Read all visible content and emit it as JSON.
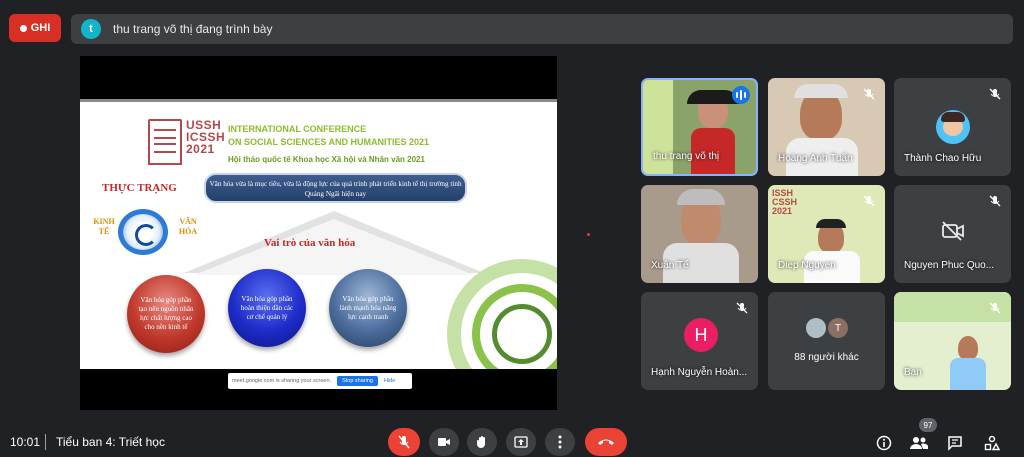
{
  "recording": {
    "label": "GHI"
  },
  "presenter_bar": {
    "avatar_letter": "t",
    "text": "thu trang võ thị đang trình bày"
  },
  "slide": {
    "logo_code": [
      "USSH",
      "ICSSH",
      "2021"
    ],
    "conference_title_line1": "INTERNATIONAL CONFERENCE",
    "conference_title_line2": "ON SOCIAL SCIENCES AND HUMANITIES 2021",
    "conference_subtitle": "Hội thảo quốc tế Khoa học Xã hội và Nhân văn 2021",
    "status_heading": "THỰC TRẠNG",
    "banner_text": "Văn hóa vừa là mục tiêu, vừa là động lực của quá trình phát triển kinh tế thị trường tỉnh Quảng Ngãi hiện nay",
    "econ_label": "KINH TẾ",
    "culture_label": "VĂN HÓA",
    "role_title": "Vai trò của văn hóa",
    "bubbles": [
      "Văn hóa góp phần tạo nên nguồn nhân lực chất lượng cao cho nền kinh tế",
      "Văn hóa góp phần hoàn thiện dần các cơ chế quản lý",
      "Văn hóa góp phần lành mạnh hóa năng lực cạnh tranh"
    ]
  },
  "share_bar": {
    "text": "meet.google.com is sharing your screen.",
    "stop_label": "Stop sharing",
    "hide_label": "Hide"
  },
  "participants": [
    {
      "name": "thu trang võ thị",
      "speaking": true
    },
    {
      "name": "Hoàng Anh Tuấn",
      "muted": true
    },
    {
      "name": "Thành Chao Hữu",
      "muted": true
    },
    {
      "name": "Xuân Tế",
      "muted": true
    },
    {
      "name": "Diep Nguyen",
      "muted": true
    },
    {
      "name": "Nguyen Phuc Quo...",
      "muted": true
    },
    {
      "name": "Hạnh Nguyễn Hoàn...",
      "muted": true,
      "avatar_letter": "H"
    },
    {
      "name": "88 người khác",
      "mini_letter": "T"
    },
    {
      "name": "Bạn",
      "muted": true
    }
  ],
  "bottom_bar": {
    "time": "10:01",
    "meeting_name": "Tiểu ban 4: Triết học",
    "participant_count": "97"
  },
  "colors": {
    "accent": "#1a73e8",
    "danger": "#ea4335",
    "background": "#202124",
    "tile": "#3c4043"
  }
}
